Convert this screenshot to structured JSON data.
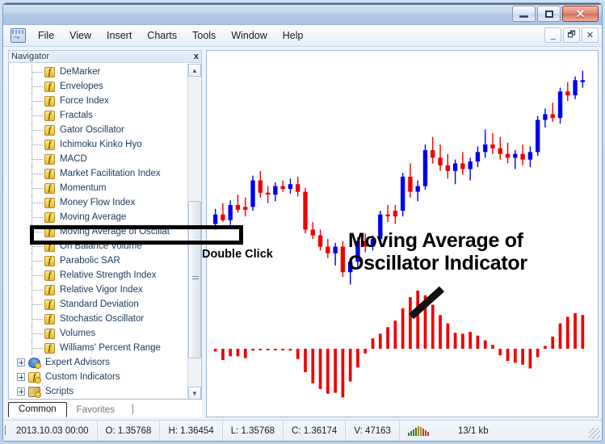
{
  "window": {
    "title": "",
    "buttons": {
      "minimize": "_",
      "maximize": "□",
      "close": "✕"
    }
  },
  "menubar": {
    "app_icon": "metatrader-icon",
    "items": [
      "File",
      "View",
      "Insert",
      "Charts",
      "Tools",
      "Window",
      "Help"
    ],
    "mdi_buttons": {
      "minimize": "_",
      "restore": "🗗",
      "close": "✕"
    }
  },
  "navigator": {
    "title": "Navigator",
    "close_label": "x",
    "indicators": [
      "DeMarker",
      "Envelopes",
      "Force Index",
      "Fractals",
      "Gator Oscillator",
      "Ichimoku Kinko Hyo",
      "MACD",
      "Market Facilitation Index",
      "Momentum",
      "Money Flow Index",
      "Moving Average",
      "Moving Average of Oscillat",
      "On Balance Volume",
      "Parabolic SAR",
      "Relative Strength Index",
      "Relative Vigor Index",
      "Standard Deviation",
      "Stochastic Oscillator",
      "Volumes",
      "Williams' Percent Range"
    ],
    "selected_index": 11,
    "folders": [
      {
        "label": "Expert Advisors",
        "icon": "expert-advisor-icon"
      },
      {
        "label": "Custom Indicators",
        "icon": "custom-indicator-icon"
      },
      {
        "label": "Scripts",
        "icon": "script-icon"
      }
    ],
    "tabs": [
      {
        "label": "Common",
        "active": true
      },
      {
        "label": "Favorites",
        "active": false
      }
    ]
  },
  "annotations": {
    "title_line1": "Moving Average of",
    "title_line2": "Oscillator Indicator",
    "double_click": "Double Click"
  },
  "statusbar": {
    "date": "2013.10.03 00:00",
    "open": "O: 1.35768",
    "high": "H: 1.36454",
    "low": "L: 1.35768",
    "close": "C: 1.36174",
    "volume": "V: 47163",
    "traffic": "13/1 kb"
  },
  "colors": {
    "bull": "#0000ee",
    "bear": "#ee0000",
    "histogram": "#ee0000",
    "annotation": "#000000",
    "chart_bg": "#ffffff"
  },
  "chart_data": {
    "type": "candlestick",
    "title": "",
    "xlabel": "",
    "ylabel": "",
    "grid": false,
    "legend": "none",
    "price_panel": {
      "ylim": [
        1.35,
        1.37
      ],
      "candles": [
        {
          "o": 1.3576,
          "h": 1.3592,
          "l": 1.357,
          "c": 1.3586,
          "dir": "up"
        },
        {
          "o": 1.3586,
          "h": 1.3598,
          "l": 1.3578,
          "c": 1.358,
          "dir": "down"
        },
        {
          "o": 1.358,
          "h": 1.3601,
          "l": 1.3575,
          "c": 1.3596,
          "dir": "up"
        },
        {
          "o": 1.3596,
          "h": 1.3607,
          "l": 1.3588,
          "c": 1.3591,
          "dir": "down"
        },
        {
          "o": 1.3591,
          "h": 1.3604,
          "l": 1.3584,
          "c": 1.3594,
          "dir": "down"
        },
        {
          "o": 1.3594,
          "h": 1.3627,
          "l": 1.359,
          "c": 1.3622,
          "dir": "up"
        },
        {
          "o": 1.3622,
          "h": 1.3632,
          "l": 1.3604,
          "c": 1.3609,
          "dir": "down"
        },
        {
          "o": 1.3609,
          "h": 1.3616,
          "l": 1.3598,
          "c": 1.3607,
          "dir": "down"
        },
        {
          "o": 1.3607,
          "h": 1.362,
          "l": 1.36,
          "c": 1.3616,
          "dir": "up"
        },
        {
          "o": 1.3616,
          "h": 1.3622,
          "l": 1.361,
          "c": 1.3613,
          "dir": "down"
        },
        {
          "o": 1.3613,
          "h": 1.3624,
          "l": 1.3608,
          "c": 1.3618,
          "dir": "up"
        },
        {
          "o": 1.3618,
          "h": 1.3626,
          "l": 1.3605,
          "c": 1.361,
          "dir": "down"
        },
        {
          "o": 1.361,
          "h": 1.3614,
          "l": 1.3566,
          "c": 1.357,
          "dir": "down"
        },
        {
          "o": 1.357,
          "h": 1.3578,
          "l": 1.356,
          "c": 1.3564,
          "dir": "down"
        },
        {
          "o": 1.3564,
          "h": 1.357,
          "l": 1.3548,
          "c": 1.3552,
          "dir": "down"
        },
        {
          "o": 1.3552,
          "h": 1.356,
          "l": 1.354,
          "c": 1.3545,
          "dir": "down"
        },
        {
          "o": 1.3545,
          "h": 1.3556,
          "l": 1.3532,
          "c": 1.3552,
          "dir": "up"
        },
        {
          "o": 1.3552,
          "h": 1.3558,
          "l": 1.352,
          "c": 1.3525,
          "dir": "down"
        },
        {
          "o": 1.3525,
          "h": 1.3538,
          "l": 1.3512,
          "c": 1.3536,
          "dir": "up"
        },
        {
          "o": 1.3536,
          "h": 1.3562,
          "l": 1.353,
          "c": 1.3558,
          "dir": "up"
        },
        {
          "o": 1.3558,
          "h": 1.3566,
          "l": 1.3546,
          "c": 1.3552,
          "dir": "down"
        },
        {
          "o": 1.3552,
          "h": 1.3564,
          "l": 1.3548,
          "c": 1.356,
          "dir": "up"
        },
        {
          "o": 1.356,
          "h": 1.359,
          "l": 1.3556,
          "c": 1.3586,
          "dir": "up"
        },
        {
          "o": 1.3586,
          "h": 1.3596,
          "l": 1.3578,
          "c": 1.3584,
          "dir": "down"
        },
        {
          "o": 1.3584,
          "h": 1.3596,
          "l": 1.3576,
          "c": 1.359,
          "dir": "down"
        },
        {
          "o": 1.359,
          "h": 1.363,
          "l": 1.3584,
          "c": 1.3626,
          "dir": "up"
        },
        {
          "o": 1.3626,
          "h": 1.364,
          "l": 1.3604,
          "c": 1.361,
          "dir": "down"
        },
        {
          "o": 1.361,
          "h": 1.3622,
          "l": 1.36,
          "c": 1.3616,
          "dir": "up"
        },
        {
          "o": 1.3616,
          "h": 1.366,
          "l": 1.3612,
          "c": 1.3654,
          "dir": "up"
        },
        {
          "o": 1.3654,
          "h": 1.3668,
          "l": 1.364,
          "c": 1.3646,
          "dir": "down"
        },
        {
          "o": 1.3646,
          "h": 1.366,
          "l": 1.3632,
          "c": 1.3638,
          "dir": "down"
        },
        {
          "o": 1.3638,
          "h": 1.365,
          "l": 1.3624,
          "c": 1.3632,
          "dir": "down"
        },
        {
          "o": 1.3632,
          "h": 1.3644,
          "l": 1.3618,
          "c": 1.364,
          "dir": "up"
        },
        {
          "o": 1.364,
          "h": 1.3652,
          "l": 1.3628,
          "c": 1.3634,
          "dir": "down"
        },
        {
          "o": 1.3634,
          "h": 1.3646,
          "l": 1.3622,
          "c": 1.3642,
          "dir": "up"
        },
        {
          "o": 1.3642,
          "h": 1.3658,
          "l": 1.3636,
          "c": 1.3652,
          "dir": "up"
        },
        {
          "o": 1.3652,
          "h": 1.3676,
          "l": 1.3646,
          "c": 1.366,
          "dir": "up"
        },
        {
          "o": 1.366,
          "h": 1.3672,
          "l": 1.365,
          "c": 1.3656,
          "dir": "down"
        },
        {
          "o": 1.3656,
          "h": 1.3668,
          "l": 1.3644,
          "c": 1.365,
          "dir": "down"
        },
        {
          "o": 1.365,
          "h": 1.3662,
          "l": 1.364,
          "c": 1.3646,
          "dir": "down"
        },
        {
          "o": 1.3646,
          "h": 1.3654,
          "l": 1.3634,
          "c": 1.365,
          "dir": "up"
        },
        {
          "o": 1.365,
          "h": 1.366,
          "l": 1.3638,
          "c": 1.3644,
          "dir": "down"
        },
        {
          "o": 1.3644,
          "h": 1.3658,
          "l": 1.3636,
          "c": 1.3652,
          "dir": "up"
        },
        {
          "o": 1.3652,
          "h": 1.369,
          "l": 1.3648,
          "c": 1.3686,
          "dir": "up"
        },
        {
          "o": 1.3686,
          "h": 1.3698,
          "l": 1.3678,
          "c": 1.3692,
          "dir": "up"
        },
        {
          "o": 1.3692,
          "h": 1.3704,
          "l": 1.3684,
          "c": 1.3688,
          "dir": "down"
        },
        {
          "o": 1.3688,
          "h": 1.372,
          "l": 1.3682,
          "c": 1.3716,
          "dir": "up"
        },
        {
          "o": 1.3716,
          "h": 1.3726,
          "l": 1.3706,
          "c": 1.3712,
          "dir": "down"
        },
        {
          "o": 1.3712,
          "h": 1.3732,
          "l": 1.3708,
          "c": 1.3728,
          "dir": "up"
        },
        {
          "o": 1.3728,
          "h": 1.3738,
          "l": 1.372,
          "c": 1.3726,
          "dir": "up"
        }
      ]
    },
    "osma_panel": {
      "name": "Moving Average of Oscillator (OsMA)",
      "zero_line": 0,
      "values": [
        -0.6,
        -2.4,
        -1.6,
        -1.6,
        -2.0,
        -0.4,
        -0.3,
        -0.3,
        -0.3,
        -0.3,
        -0.4,
        -2.2,
        -5.0,
        -7.4,
        -8.6,
        -9.6,
        -9.4,
        -10.4,
        -7.0,
        -4.0,
        -1.0,
        2.2,
        3.2,
        4.6,
        6.0,
        8.6,
        11.0,
        12.4,
        11.4,
        9.4,
        7.2,
        5.4,
        3.4,
        3.2,
        3.6,
        2.8,
        1.8,
        0.8,
        -1.4,
        -2.6,
        -3.0,
        -3.4,
        -4.2,
        -1.8,
        0.6,
        2.6,
        5.4,
        6.8,
        7.6,
        7.2
      ]
    }
  }
}
